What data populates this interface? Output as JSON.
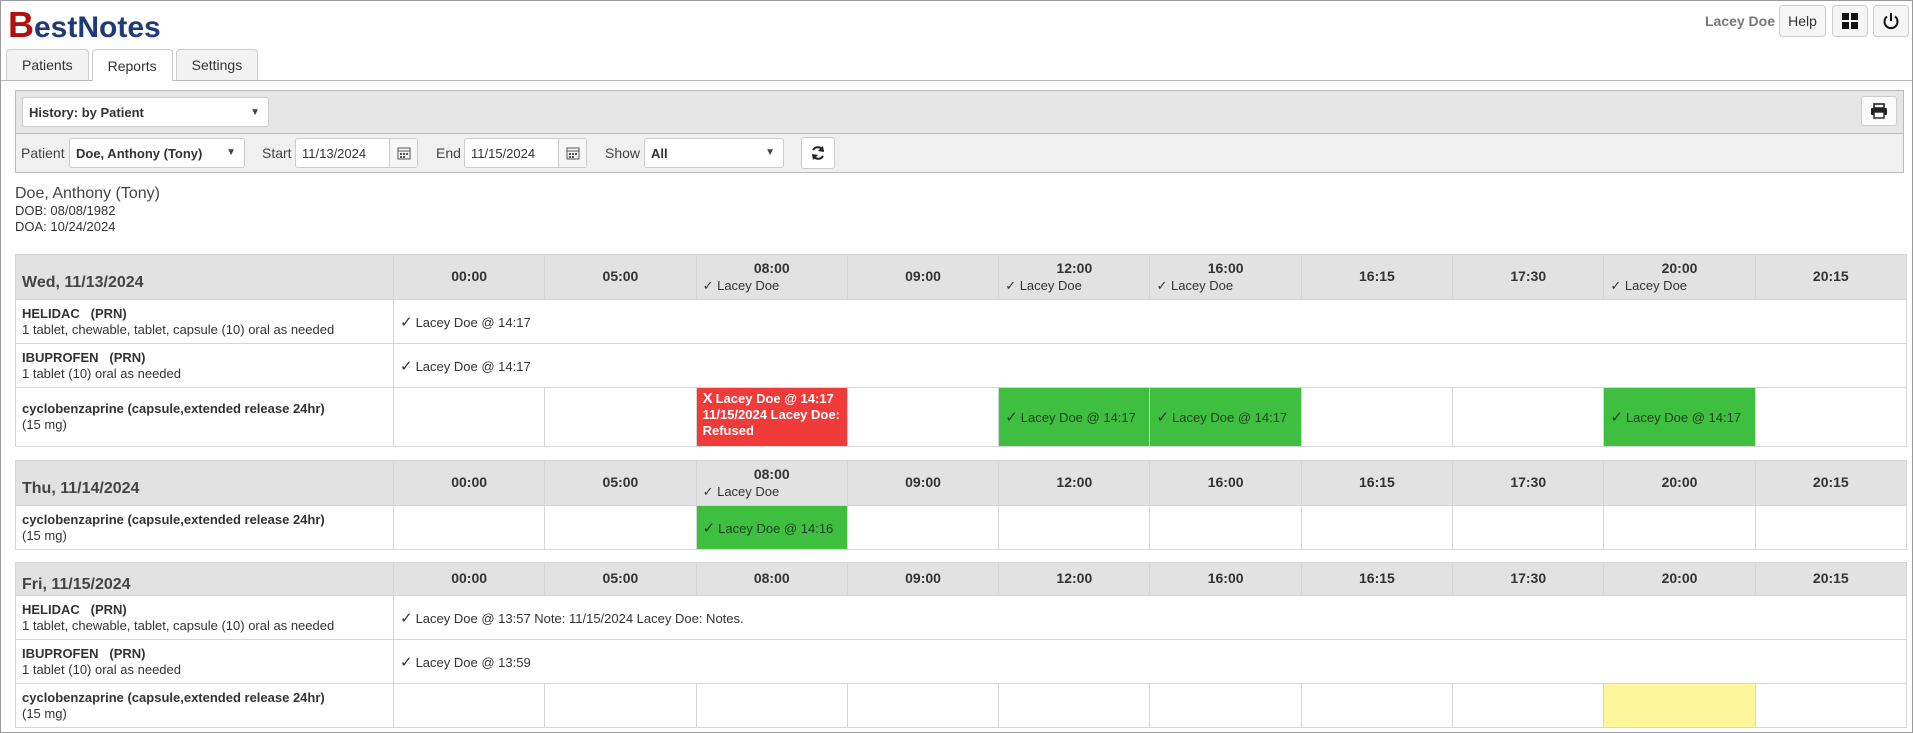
{
  "app": {
    "logo_b": "B",
    "logo_rest": "estNotes",
    "user": "Lacey Doe",
    "help": "Help"
  },
  "tabs": [
    {
      "label": "Patients"
    },
    {
      "label": "Reports"
    },
    {
      "label": "Settings"
    }
  ],
  "toolbar": {
    "report": "History: by Patient",
    "patient_label": "Patient",
    "patient": "Doe, Anthony (Tony)",
    "start_label": "Start",
    "start": "11/13/2024",
    "end_label": "End",
    "end": "11/15/2024",
    "show_label": "Show",
    "show": "All"
  },
  "patient_info": {
    "name": "Doe, Anthony (Tony)",
    "dob": "DOB: 08/08/1982",
    "doa": "DOA: 10/24/2024"
  },
  "times": [
    "00:00",
    "05:00",
    "08:00",
    "09:00",
    "12:00",
    "16:00",
    "16:15",
    "17:30",
    "20:00",
    "20:15"
  ],
  "days": [
    {
      "date": "Wed, 11/13/2024",
      "header_notes": [
        "",
        "",
        "✓ Lacey Doe",
        "",
        "✓ Lacey Doe",
        "✓ Lacey Doe",
        "",
        "",
        "✓ Lacey Doe",
        ""
      ],
      "rows": [
        {
          "name": "HELIDAC",
          "tag": "(PRN)",
          "detail": "1 tablet, chewable, tablet, capsule (10) oral as needed",
          "span_text": "Lacey Doe @ 14:17"
        },
        {
          "name": "IBUPROFEN",
          "tag": "(PRN)",
          "detail": "1 tablet (10) oral as needed",
          "span_text": "Lacey Doe @ 14:17"
        },
        {
          "name": "cyclobenzaprine (capsule,extended release 24hr)",
          "tag": "",
          "detail": "(15 mg)",
          "cells": [
            {
              "type": "empty"
            },
            {
              "type": "empty"
            },
            {
              "type": "refused",
              "mark": "X",
              "text": "Lacey Doe @ 14:17",
              "note": "11/15/2024 Lacey Doe: Refused"
            },
            {
              "type": "empty"
            },
            {
              "type": "ok",
              "text": "Lacey Doe @ 14:17"
            },
            {
              "type": "ok",
              "text": "Lacey Doe @ 14:17"
            },
            {
              "type": "empty"
            },
            {
              "type": "empty"
            },
            {
              "type": "ok",
              "text": "Lacey Doe @ 14:17"
            },
            {
              "type": "empty"
            }
          ]
        }
      ]
    },
    {
      "date": "Thu, 11/14/2024",
      "header_notes": [
        "",
        "",
        "✓ Lacey Doe",
        "",
        "",
        "",
        "",
        "",
        "",
        ""
      ],
      "rows": [
        {
          "name": "cyclobenzaprine (capsule,extended release 24hr)",
          "tag": "",
          "detail": "(15 mg)",
          "cells": [
            {
              "type": "empty"
            },
            {
              "type": "empty"
            },
            {
              "type": "ok",
              "text": "Lacey Doe @ 14:16"
            },
            {
              "type": "empty"
            },
            {
              "type": "empty"
            },
            {
              "type": "empty"
            },
            {
              "type": "empty"
            },
            {
              "type": "empty"
            },
            {
              "type": "empty"
            },
            {
              "type": "empty"
            }
          ]
        }
      ]
    },
    {
      "date": "Fri, 11/15/2024",
      "header_notes": [
        "",
        "",
        "",
        "",
        "",
        "",
        "",
        "",
        "",
        ""
      ],
      "rows": [
        {
          "name": "HELIDAC",
          "tag": "(PRN)",
          "detail": "1 tablet, chewable, tablet, capsule (10) oral as needed",
          "span_text": "Lacey Doe @ 13:57 Note: 11/15/2024 Lacey Doe: Notes."
        },
        {
          "name": "IBUPROFEN",
          "tag": "(PRN)",
          "detail": "1 tablet (10) oral as needed",
          "span_text": "Lacey Doe @ 13:59"
        },
        {
          "name": "cyclobenzaprine (capsule,extended release 24hr)",
          "tag": "",
          "detail": "(15 mg)",
          "cells": [
            {
              "type": "empty"
            },
            {
              "type": "empty"
            },
            {
              "type": "empty"
            },
            {
              "type": "empty"
            },
            {
              "type": "empty"
            },
            {
              "type": "empty"
            },
            {
              "type": "empty"
            },
            {
              "type": "empty"
            },
            {
              "type": "pending"
            },
            {
              "type": "empty"
            }
          ]
        }
      ]
    }
  ],
  "colors": {
    "ok": "#3fbf3f",
    "refused": "#f13a3a",
    "pending": "#fff59a",
    "header_bg": "#e2e2e2"
  }
}
